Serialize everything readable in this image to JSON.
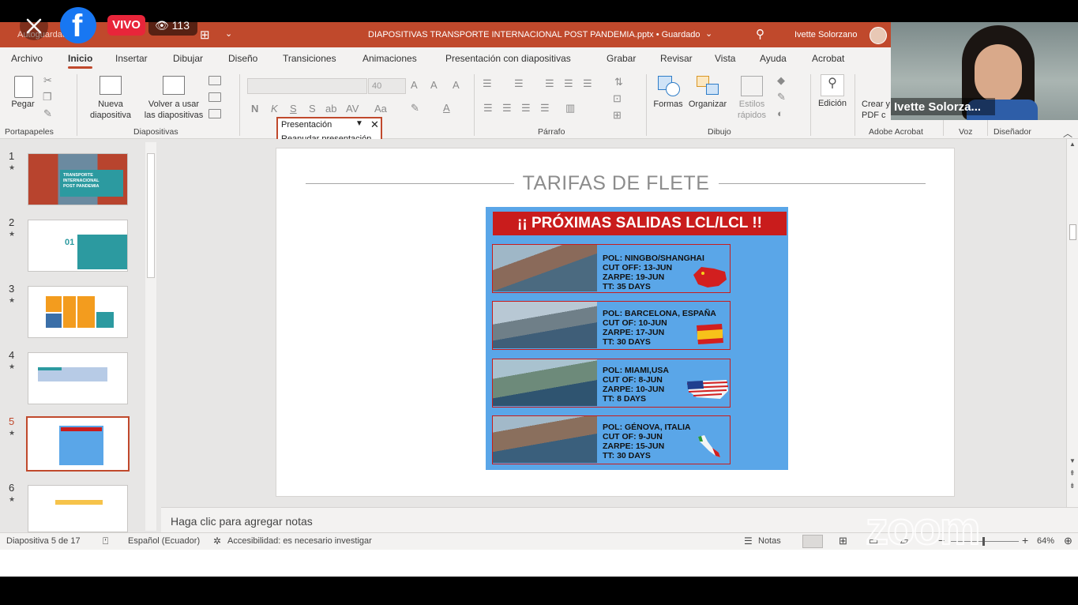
{
  "facebook": {
    "live_label": "VIVO",
    "viewer_count": "113"
  },
  "titlebar": {
    "autosave": "Autoguardado",
    "doc_title": "DIAPOSITIVAS TRANSPORTE INTERNACIONAL POST PANDEMIA.pptx • Guardado",
    "user": "Ivette Solorzano"
  },
  "tabs": [
    "Archivo",
    "Inicio",
    "Insertar",
    "Dibujar",
    "Diseño",
    "Transiciones",
    "Animaciones",
    "Presentación con diapositivas",
    "Grabar",
    "Revisar",
    "Vista",
    "Ayuda",
    "Acrobat"
  ],
  "ribbon": {
    "paste": "Pegar",
    "new_slide": "Nueva\ndiapositiva",
    "reuse": "Volver a usar\nlas diapositivas",
    "font_size": "40",
    "shapes": "Formas",
    "arrange": "Organizar",
    "quick_styles": "Estilos\nrápidos",
    "editing": "Edición",
    "create_pdf": "Crear y\nPDF c",
    "groups": {
      "clipboard": "Portapapeles",
      "slides": "Diapositivas",
      "paragraph": "Párrafo",
      "drawing": "Dibujo",
      "acrobat": "Adobe Acrobat",
      "voice": "Voz",
      "designer": "Diseñador"
    }
  },
  "popup": {
    "title": "Presentación",
    "item": "Reanudar presentación"
  },
  "thumbnails": [
    {
      "num": "1",
      "text": "TRANSPORTE\nINTERNACIONAL\nPOST PANDEMIA"
    },
    {
      "num": "2",
      "text": "01"
    },
    {
      "num": "3",
      "text": ""
    },
    {
      "num": "4",
      "text": ""
    },
    {
      "num": "5",
      "text": ""
    },
    {
      "num": "6",
      "text": ""
    }
  ],
  "slide": {
    "title": "TARIFAS DE FLETE",
    "poster_heading": "¡¡ PRÓXIMAS SALIDAS LCL/LCL !!",
    "departures": [
      {
        "pol": "POL: NINGBO/SHANGHAI",
        "cutoff": "CUT OFF: 13-JUN",
        "zarpe": "ZARPE: 19-JUN",
        "tt": "TT: 35 DAYS",
        "flag": "china-flag"
      },
      {
        "pol": "POL:  BARCELONA, ESPAÑA",
        "cutoff": "CUT OF: 10-JUN",
        "zarpe": "ZARPE: 17-JUN",
        "tt": "TT: 30 DAYS",
        "flag": "spain-flag"
      },
      {
        "pol": "POL:  MIAMI,USA",
        "cutoff": "CUT OF: 8-JUN",
        "zarpe": "ZARPE: 10-JUN",
        "tt": "TT: 8 DAYS",
        "flag": "usa-flag"
      },
      {
        "pol": "POL:  GÉNOVA, ITALIA",
        "cutoff": "CUT OF: 9-JUN",
        "zarpe": "ZARPE: 15-JUN",
        "tt": "TT: 30 DAYS",
        "flag": "italy-flag"
      }
    ]
  },
  "notes_placeholder": "Haga clic para agregar notas",
  "status": {
    "slide_pos": "Diapositiva 5 de 17",
    "language": "Español (Ecuador)",
    "accessibility": "Accesibilidad: es necesario investigar",
    "notes": "Notas",
    "zoom": "64%"
  },
  "video": {
    "name": "Ivette Solorza..."
  },
  "zoom_watermark": "zoom",
  "colors": {
    "accent": "#c0492c",
    "poster_blue": "#5aa6e8",
    "poster_red": "#c91c1c",
    "facebook": "#1877f2",
    "live_red": "#e8253a"
  }
}
